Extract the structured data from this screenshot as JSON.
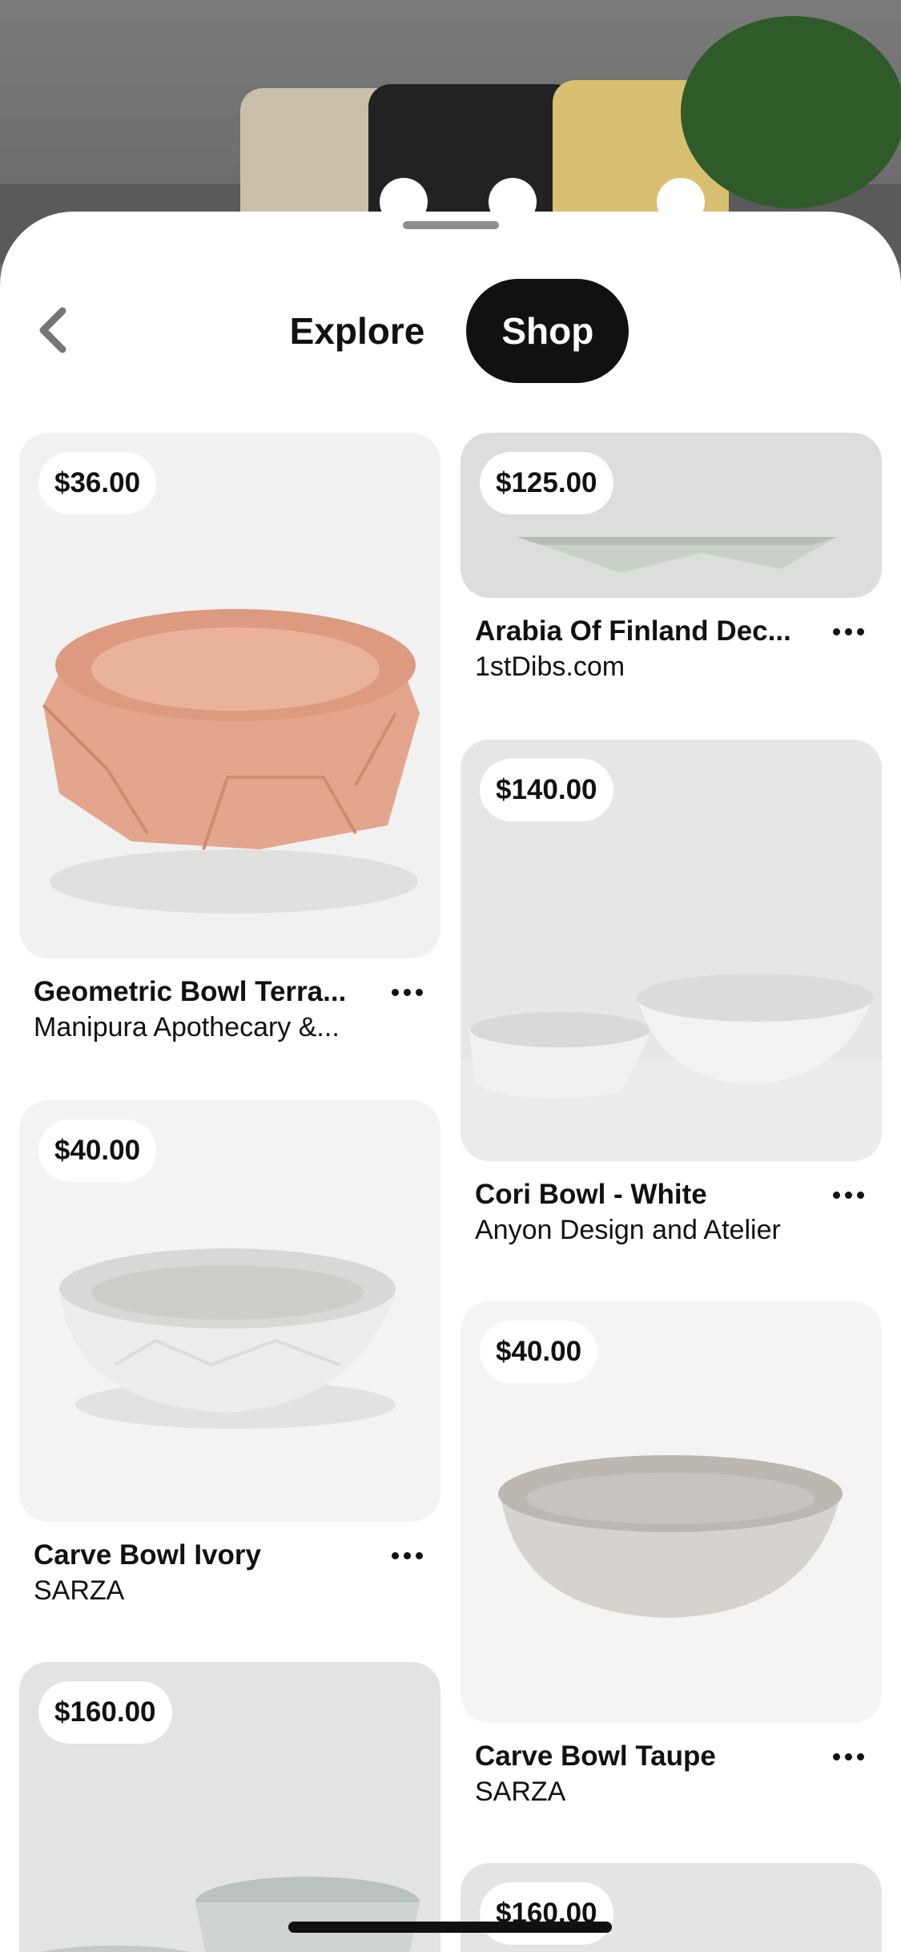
{
  "nav": {
    "back_icon": "chevron-left-icon",
    "tabs": [
      {
        "label": "Explore",
        "active": false
      },
      {
        "label": "Shop",
        "active": true
      }
    ]
  },
  "products": [
    {
      "price": "$36.00",
      "title": "Geometric Bowl Terra...",
      "seller": "Manipura Apothecary &..."
    },
    {
      "price": "$125.00",
      "title": "Arabia Of Finland Dec...",
      "seller": "1stDibs.com"
    },
    {
      "price": "$40.00",
      "title": "Carve Bowl Ivory",
      "seller": "SARZA"
    },
    {
      "price": "$140.00",
      "title": "Cori Bowl - White",
      "seller": "Anyon Design and Atelier"
    },
    {
      "price": "$40.00",
      "title": "Carve Bowl Taupe",
      "seller": "SARZA"
    },
    {
      "price": "$160.00",
      "title": "",
      "seller": ""
    },
    {
      "price": "$160.00",
      "title": "",
      "seller": ""
    }
  ],
  "colors": {
    "tab_active_bg": "#111111",
    "terracotta": "#e4a58d"
  }
}
